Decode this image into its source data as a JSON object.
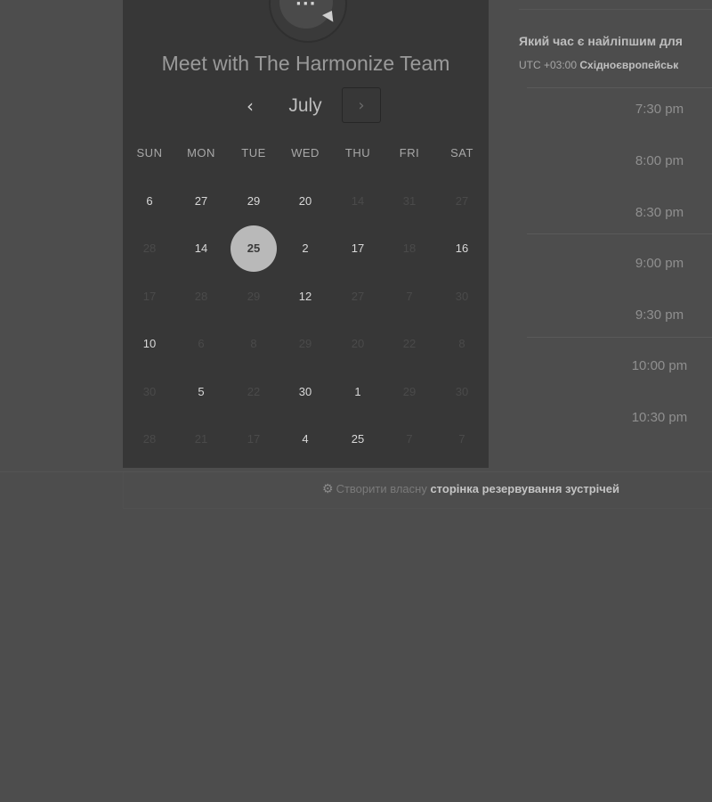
{
  "header": {
    "title": "Meet with The Harmonize Team"
  },
  "calendar": {
    "month": "July",
    "prev_icon": "‹",
    "next_icon": "›",
    "weekdays": [
      "SUN",
      "MON",
      "TUE",
      "WED",
      "THU",
      "FRI",
      "SAT"
    ],
    "weeks": [
      [
        {
          "label": "6",
          "active": true
        },
        {
          "label": "27",
          "active": true
        },
        {
          "label": "29",
          "active": true
        },
        {
          "label": "20",
          "active": true
        },
        {
          "label": "14",
          "active": false
        },
        {
          "label": "31",
          "active": false
        },
        {
          "label": "27",
          "active": false
        }
      ],
      [
        {
          "label": "28",
          "active": false
        },
        {
          "label": "14",
          "active": true
        },
        {
          "label": "25",
          "active": true,
          "selected": true
        },
        {
          "label": "2",
          "active": true
        },
        {
          "label": "17",
          "active": true
        },
        {
          "label": "18",
          "active": false
        },
        {
          "label": "16",
          "active": true
        }
      ],
      [
        {
          "label": "17",
          "active": false
        },
        {
          "label": "28",
          "active": false
        },
        {
          "label": "29",
          "active": false
        },
        {
          "label": "12",
          "active": true
        },
        {
          "label": "27",
          "active": false
        },
        {
          "label": "7",
          "active": false
        },
        {
          "label": "30",
          "active": false
        }
      ],
      [
        {
          "label": "10",
          "active": true
        },
        {
          "label": "6",
          "active": false
        },
        {
          "label": "8",
          "active": false
        },
        {
          "label": "29",
          "active": false
        },
        {
          "label": "20",
          "active": false
        },
        {
          "label": "22",
          "active": false
        },
        {
          "label": "8",
          "active": false
        }
      ],
      [
        {
          "label": "30",
          "active": false
        },
        {
          "label": "5",
          "active": true
        },
        {
          "label": "22",
          "active": false
        },
        {
          "label": "30",
          "active": true
        },
        {
          "label": "1",
          "active": true
        },
        {
          "label": "29",
          "active": false
        },
        {
          "label": "30",
          "active": false
        }
      ],
      [
        {
          "label": "28",
          "active": false
        },
        {
          "label": "21",
          "active": false
        },
        {
          "label": "17",
          "active": false
        },
        {
          "label": "4",
          "active": true
        },
        {
          "label": "25",
          "active": true
        },
        {
          "label": "7",
          "active": false
        },
        {
          "label": "7",
          "active": false
        }
      ]
    ]
  },
  "times": {
    "question": "Який час є найліпшим для",
    "tz_prefix": "UTC +03:00",
    "tz_name": "Східноєвропейськ",
    "slots": [
      "7:30 pm",
      "8:00 pm",
      "8:30 pm",
      "9:00 pm",
      "9:30 pm",
      "10:00 pm",
      "10:30 pm"
    ]
  },
  "footer": {
    "icon": "sprocket-icon",
    "plain": "Створити власну",
    "bold": "сторінка резервування зустрічей"
  }
}
